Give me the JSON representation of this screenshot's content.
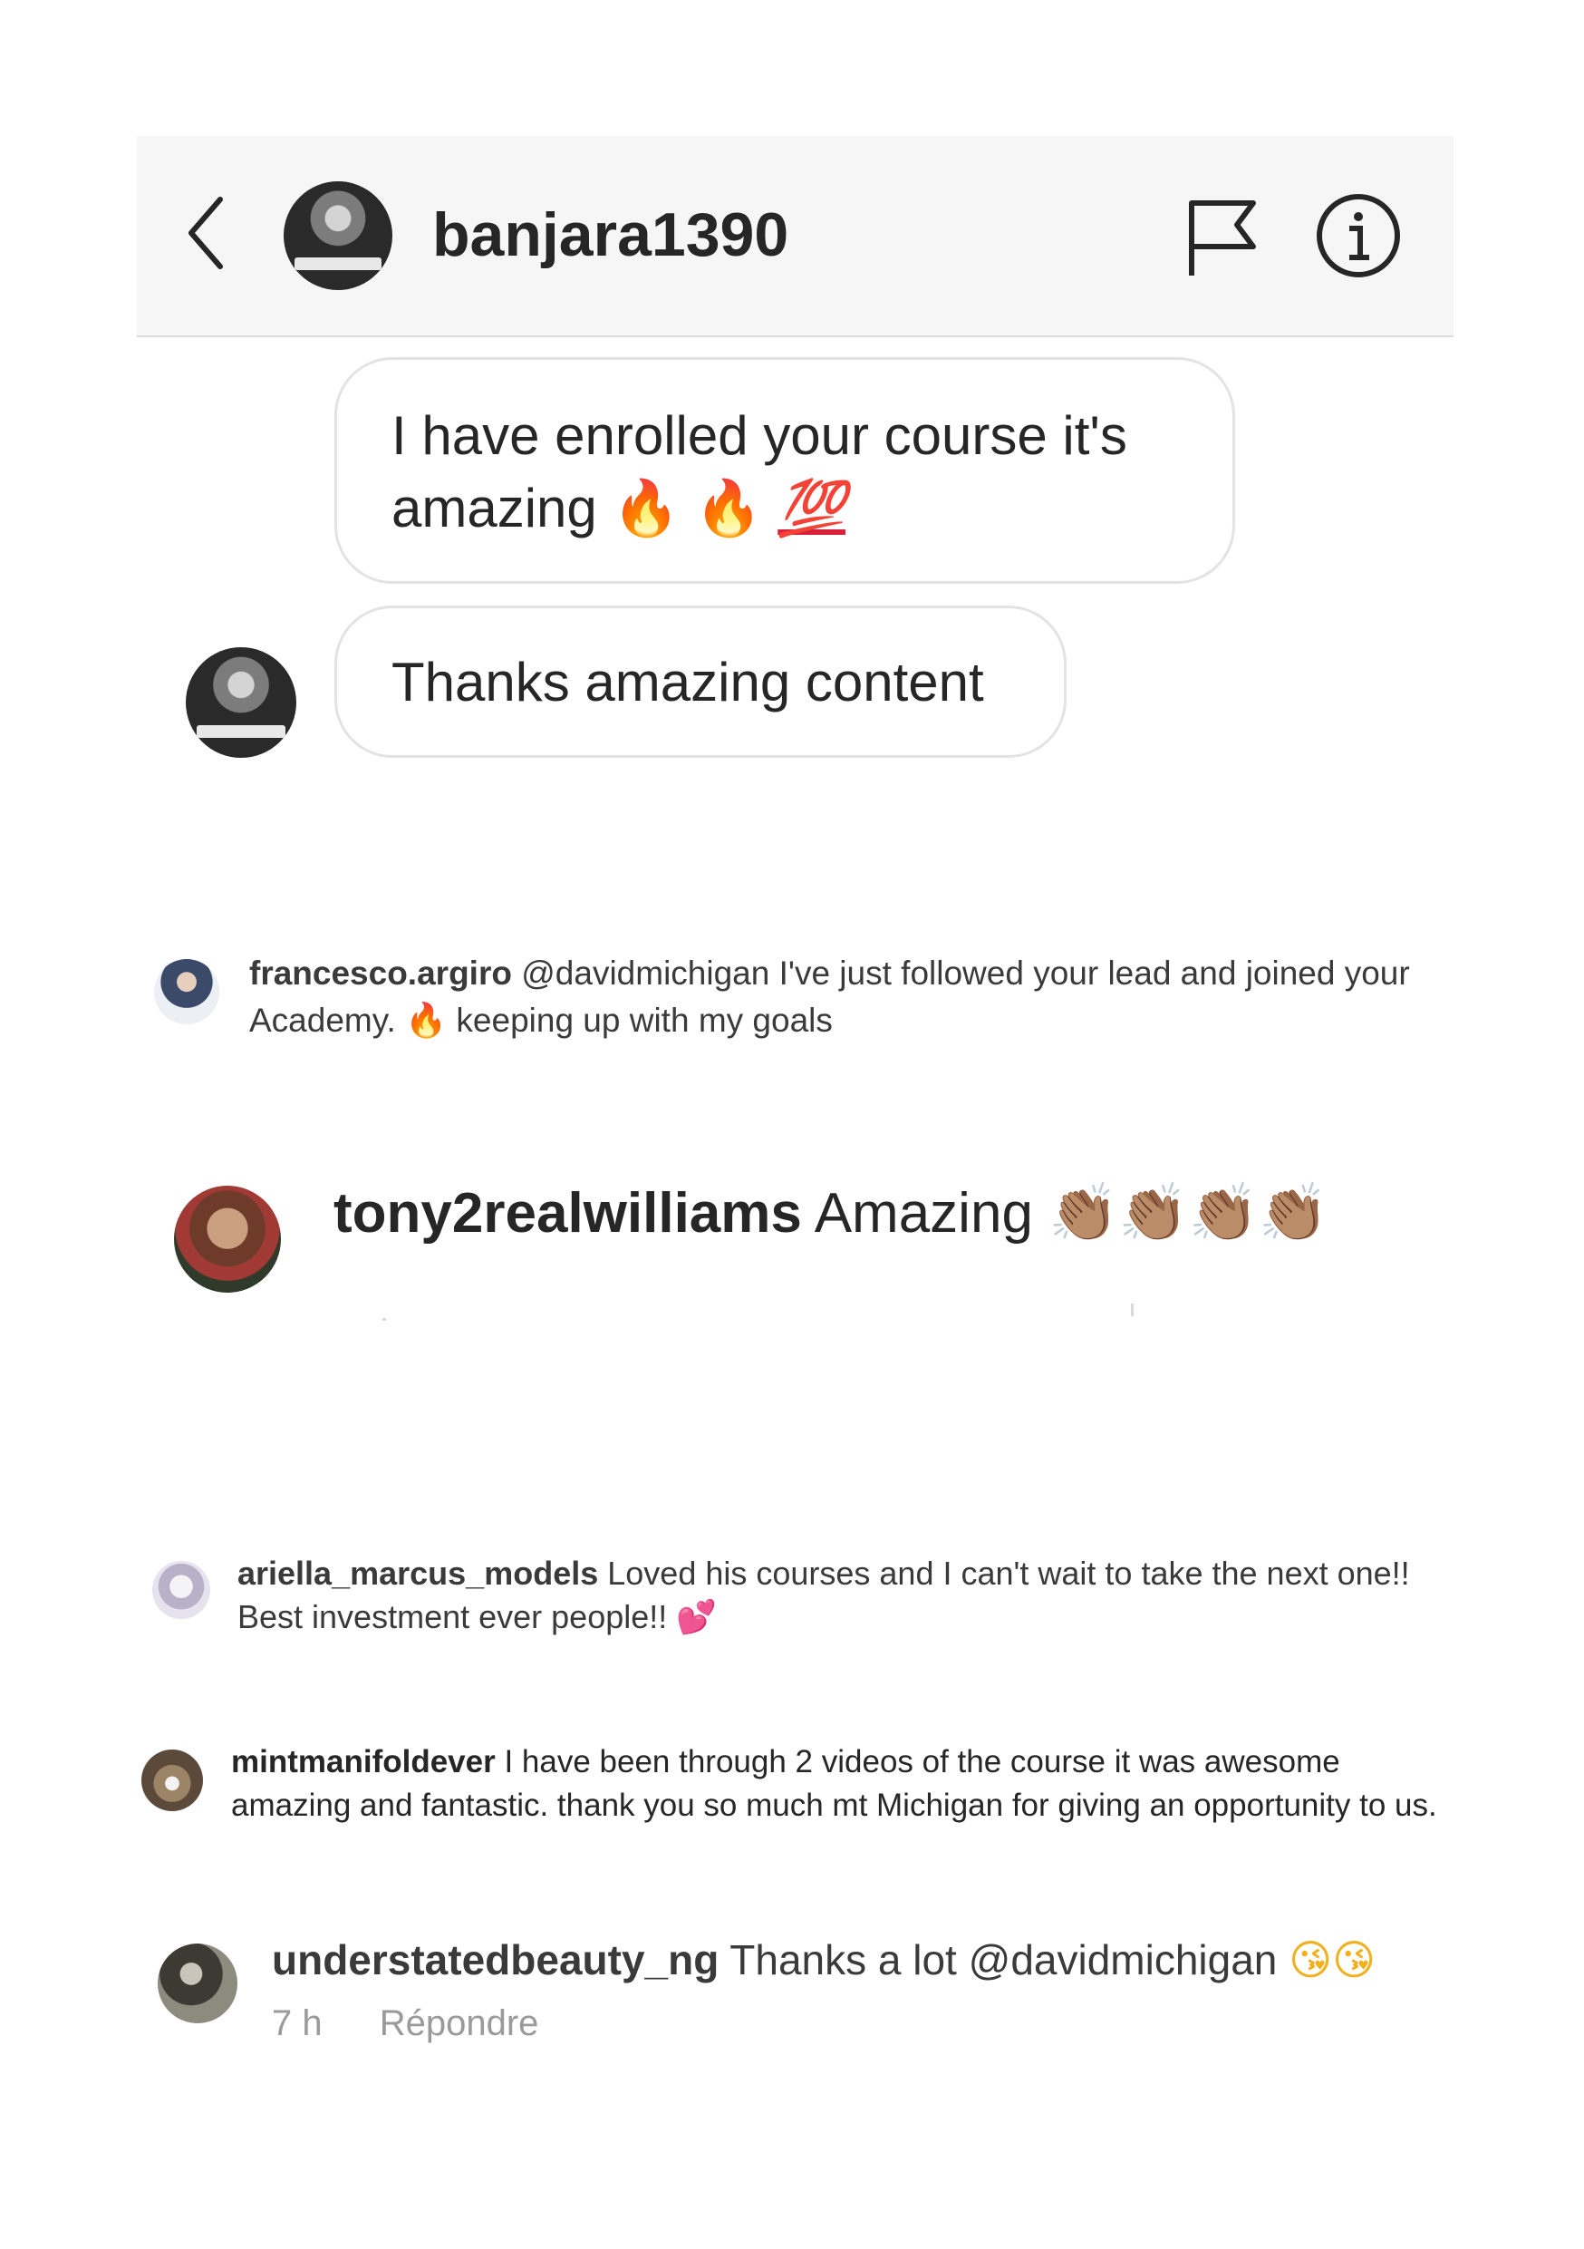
{
  "header": {
    "username": "banjara1390",
    "icons": {
      "back": "chevron-left-icon",
      "report": "flag-icon",
      "info": "info-icon"
    }
  },
  "messages": [
    {
      "text_line1": "I have enrolled your course it's",
      "text_line2": "amazing",
      "emojis": [
        "🔥",
        "🔥",
        "💯"
      ]
    },
    {
      "text": "Thanks amazing content"
    }
  ],
  "comments": [
    {
      "username": "francesco.argiro",
      "text_before": "@davidmichigan I've just followed your lead and joined your Academy.",
      "emoji": "🔥",
      "text_after": "keeping up with my goals"
    },
    {
      "username": "tony2realwilliams",
      "text": "Amazing",
      "emojis": "👏🏽👏🏽👏🏽👏🏽"
    },
    {
      "username": "ariella_marcus_models",
      "text": "Loved his courses and I can't wait to take the next one!! Best investment ever people!!",
      "emoji": "💕"
    },
    {
      "username": "mintmanifoldever",
      "text": "I have been through 2 videos of the course it was awesome amazing and fantastic. thank you so much mt Michigan for giving an opportunity to us."
    },
    {
      "username": "understatedbeauty_ng",
      "text": "Thanks a lot @davidmichigan",
      "emojis": "😘😘",
      "time": "7 h",
      "reply_label": "Répondre"
    }
  ],
  "colors": {
    "header_bg": "#f6f6f6",
    "bubble_border": "#e3e3e3",
    "text": "#262626",
    "meta_text": "#9a9a9a"
  }
}
